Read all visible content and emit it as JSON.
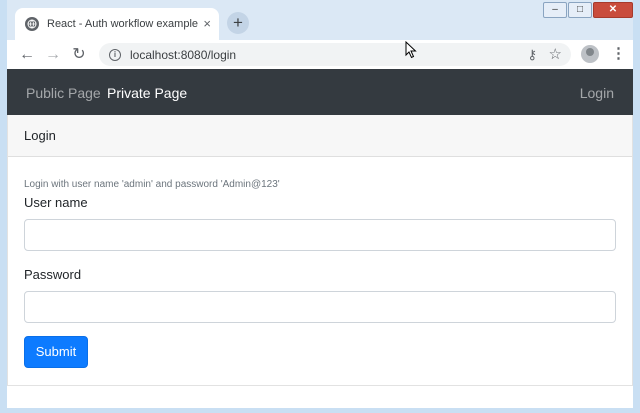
{
  "browser": {
    "tab_title": "React - Auth workflow example",
    "tab_close": "×",
    "new_tab": "+",
    "url": "localhost:8080/login",
    "window_controls": {
      "minimize": "–",
      "maximize": "□",
      "close": "✕"
    }
  },
  "navbar": {
    "links": [
      "Public Page",
      "Private Page"
    ],
    "login": "Login"
  },
  "card": {
    "header": "Login",
    "help_text": "Login with user name 'admin' and password 'Admin@123'",
    "username_label": "User name",
    "username_value": "",
    "password_label": "Password",
    "password_value": "",
    "submit_label": "Submit"
  },
  "colors": {
    "navbar_bg": "#343a40",
    "primary_button": "#0d7bff"
  },
  "icons": [
    "globe-icon",
    "back-icon",
    "forward-icon",
    "reload-icon",
    "info-icon",
    "key-icon",
    "star-icon",
    "profile-icon",
    "menu-icon"
  ]
}
